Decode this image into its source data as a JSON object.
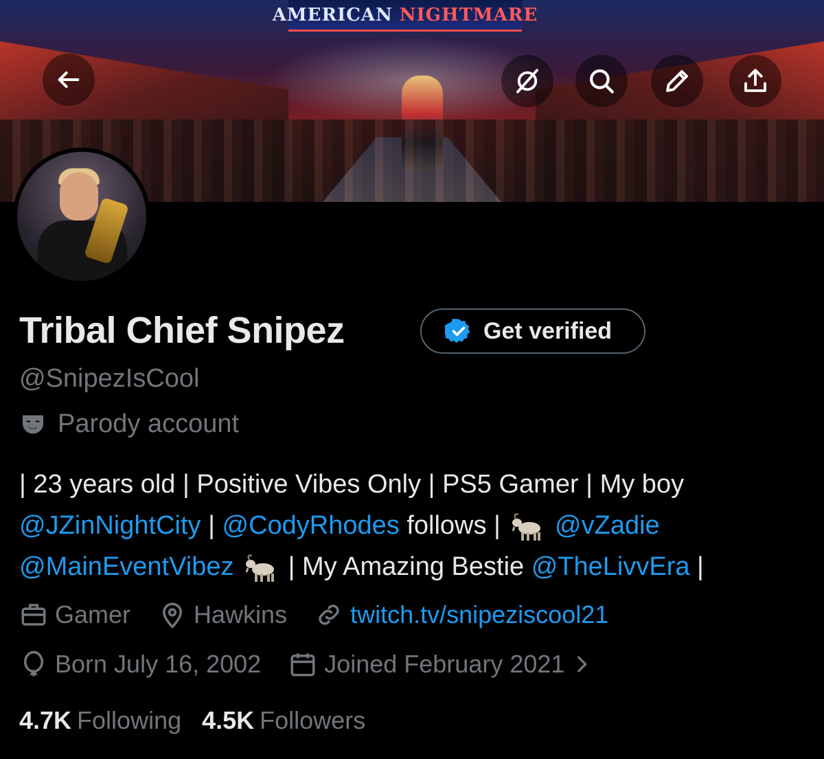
{
  "header": {
    "banner_sign": [
      "AMERICAN",
      "NIGHTMARE"
    ],
    "icons": [
      "back-arrow-icon",
      "grok-icon",
      "search-icon",
      "edit-icon",
      "share-icon"
    ]
  },
  "profile": {
    "display_name": "Tribal Chief Snipez",
    "get_verified_label": "Get verified",
    "handle": "@SnipezIsCool",
    "parody_label": "Parody account",
    "bio": {
      "line1": "| 23 years old | Positive Vibes Only | PS5 Gamer | My boy",
      "mention_jz": "@JZinNightCity",
      "sep1": " | ",
      "mention_cody": "@CodyRhodes",
      "follows_text": " follows | ",
      "mention_zadie": "@vZadie",
      "mention_mainevent": "@MainEventVibez",
      "bestie_text": " | My Amazing Bestie ",
      "mention_livv": "@TheLivvEra",
      "trailing": " |",
      "emoji": "goat"
    },
    "profession": "Gamer",
    "location": "Hawkins",
    "website": "twitch.tv/snipeziscool21",
    "birthday": "Born July 16, 2002",
    "joined": "Joined February 2021",
    "following_count": "4.7K",
    "following_label": "Following",
    "followers_count": "4.5K",
    "followers_label": "Followers"
  },
  "colors": {
    "background": "#000000",
    "text_primary": "#e7e9ea",
    "text_secondary": "#71767b",
    "link": "#1d9bf0",
    "button_border": "#536471"
  }
}
